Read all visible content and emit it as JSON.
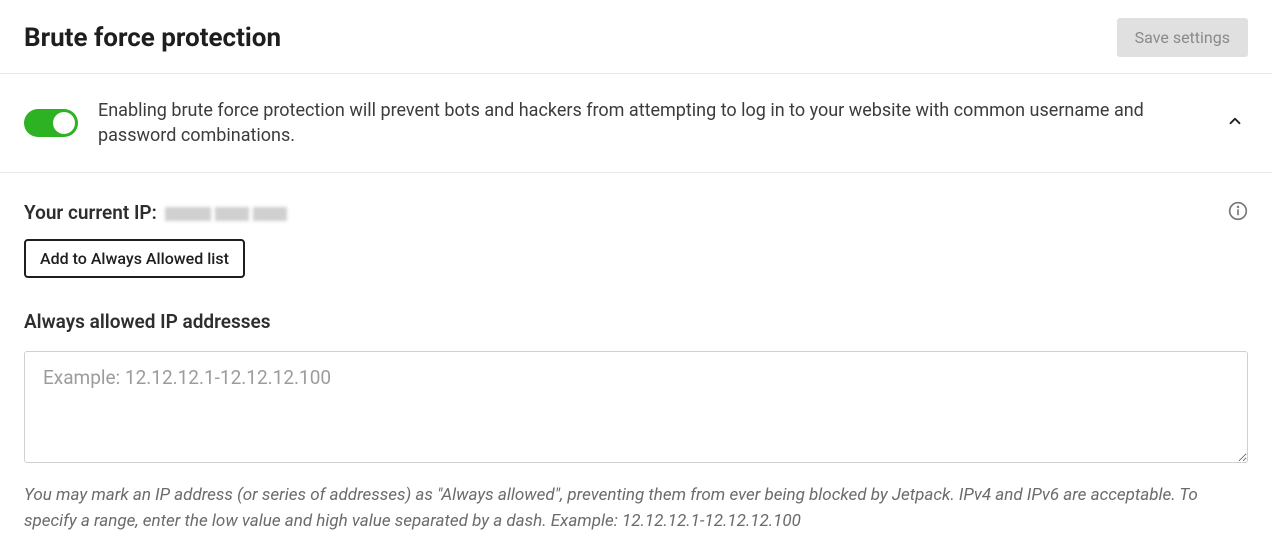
{
  "header": {
    "title": "Brute force protection",
    "save_label": "Save settings"
  },
  "toggle": {
    "enabled": true,
    "description": "Enabling brute force protection will prevent bots and hackers from attempting to log in to your website with common username and password combinations."
  },
  "current_ip": {
    "label": "Your current IP:",
    "value_obscured": true,
    "add_button_label": "Add to Always Allowed list"
  },
  "allowed": {
    "label": "Always allowed IP addresses",
    "placeholder": "Example: 12.12.12.1-12.12.12.100",
    "value": "",
    "help_text": "You may mark an IP address (or series of addresses) as \"Always allowed\", preventing them from ever being blocked by Jetpack. IPv4 and IPv6 are acceptable. To specify a range, enter the low value and high value separated by a dash. Example: 12.12.12.1-12.12.12.100"
  }
}
